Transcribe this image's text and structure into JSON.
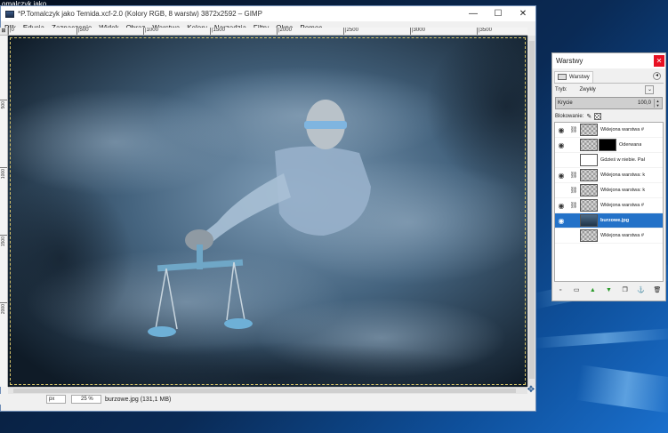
{
  "desktop": {
    "top_label": "omalczyk jako",
    "accent": "#0e4f9a"
  },
  "gimp": {
    "title": "*P.Tomalczyk jako Temida.xcf-2.0 (Kolory RGB, 8 warstw) 3872x2592 – GIMP",
    "window_controls": {
      "minimize": "—",
      "maximize": "☐",
      "close": "✕"
    },
    "menu": [
      "Plik",
      "Edycja",
      "Zaznaczenie",
      "Widok",
      "Obraz",
      "Warstwa",
      "Kolory",
      "Narzędzia",
      "Filtry",
      "Okna",
      "Pomoc"
    ],
    "ruler_top": [
      "|0",
      "|500",
      "|1000",
      "|1500",
      "|2000",
      "|2500",
      "|3000",
      "|3500"
    ],
    "ruler_left": [
      "500",
      "1000",
      "1500",
      "2000"
    ],
    "statusbar": {
      "unit": "px",
      "zoom": "25 %",
      "info": "burzowe.jpg (131,1 MB)"
    }
  },
  "layers_dock": {
    "title": "Warstwy",
    "close": "✕",
    "tab_label": "Warstwy",
    "mode_label": "Tryb:",
    "mode_value": "Zwykły",
    "opacity_label": "Krycie",
    "opacity_value": "100,0",
    "lock_label": "Blokowanie:",
    "layers": [
      {
        "name": "Wklejona warstwa #",
        "visible": true,
        "chain": true,
        "thumb": "checker",
        "mask": false,
        "selected": false
      },
      {
        "name": "Oderwana",
        "visible": true,
        "chain": false,
        "thumb": "checker",
        "mask": true,
        "selected": false
      },
      {
        "name": "Gdzieś w niebie. Pał",
        "visible": false,
        "chain": false,
        "thumb": "white",
        "mask": false,
        "selected": false
      },
      {
        "name": "Wklejona warstwa: k",
        "visible": true,
        "chain": true,
        "thumb": "checker",
        "mask": false,
        "selected": false
      },
      {
        "name": "Wklejona warstwa: k",
        "visible": false,
        "chain": true,
        "thumb": "checker",
        "mask": false,
        "selected": false
      },
      {
        "name": "Wklejona warstwa #",
        "visible": true,
        "chain": true,
        "thumb": "checker",
        "mask": false,
        "selected": false
      },
      {
        "name": "burzowe.jpg",
        "visible": true,
        "chain": false,
        "thumb": "storm",
        "mask": false,
        "selected": true
      },
      {
        "name": "Wklejona warstwa #",
        "visible": false,
        "chain": false,
        "thumb": "checker",
        "mask": false,
        "selected": false
      }
    ],
    "tools": [
      "new-layer-icon",
      "new-group-icon",
      "raise-layer-icon",
      "lower-layer-icon",
      "duplicate-layer-icon",
      "anchor-layer-icon",
      "delete-layer-icon"
    ]
  }
}
